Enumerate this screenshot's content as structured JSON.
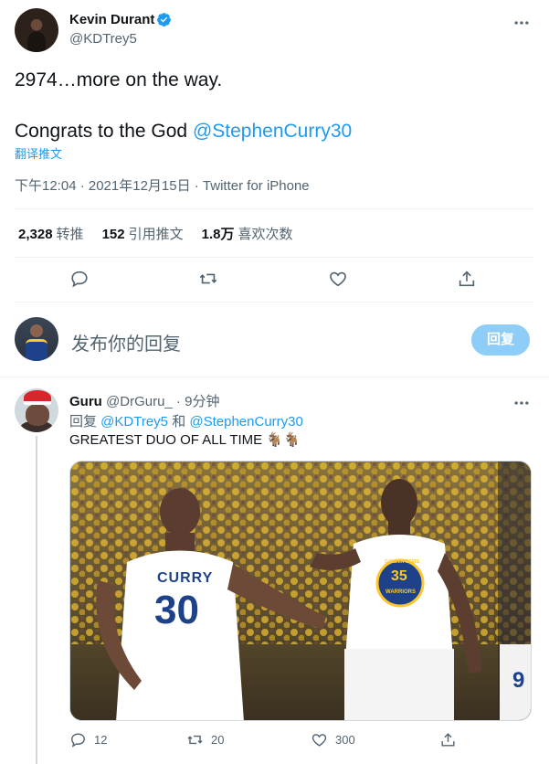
{
  "tweet": {
    "author_name": "Kevin Durant",
    "author_handle": "@KDTrey5",
    "text_line1": "2974…more on the way.",
    "text_line2_prefix": "Congrats to the God ",
    "text_line2_mention": "@StephenCurry30",
    "translate_label": "翻译推文",
    "meta": "下午12:04 · 2021年12月15日 · Twitter for iPhone"
  },
  "stats": {
    "retweets_count": "2,328",
    "retweets_label": "转推",
    "quotes_count": "152",
    "quotes_label": "引用推文",
    "likes_count": "1.8万",
    "likes_label": "喜欢次数"
  },
  "icons": {
    "verified": "verified-badge-icon",
    "more": "more-horizontal-icon",
    "reply": "reply-icon",
    "retweet": "retweet-icon",
    "like": "heart-icon",
    "share": "share-icon"
  },
  "compose": {
    "placeholder": "发布你的回复",
    "button_label": "回复"
  },
  "reply": {
    "author_name": "Guru",
    "author_handle": "@DrGuru_",
    "time": " · 9分钟",
    "reply_to_prefix": "回复 ",
    "reply_to_user1": "@KDTrey5",
    "reply_to_and": " 和 ",
    "reply_to_user2": "@StephenCurry30",
    "text": "GREATEST DUO OF ALL TIME ",
    "emoji": "🐐🐐",
    "photo": {
      "left_jersey_name": "CURRY",
      "left_jersey_number": "30",
      "right_jersey_logo_top": "GOLDEN STATE",
      "right_jersey_number": "35",
      "right_jersey_logo_bottom": "WARRIORS",
      "right_edge_number": "9"
    },
    "reply_count": "12",
    "retweet_count": "20",
    "like_count": "300"
  },
  "colors": {
    "accent": "#1d9bf0",
    "secondary_text": "#536471",
    "button_disabled": "#8ecdf8"
  }
}
